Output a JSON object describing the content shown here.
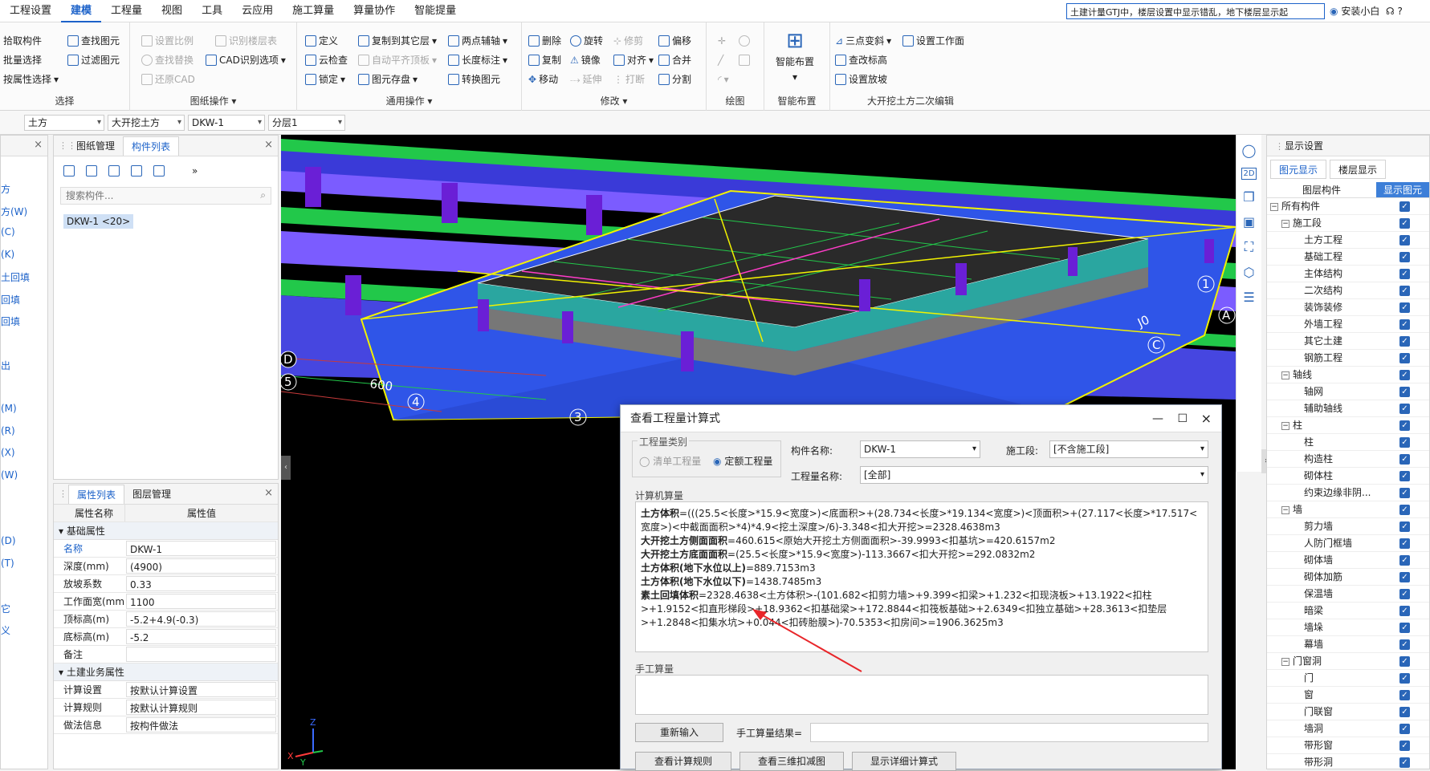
{
  "menu": {
    "tabs": [
      "工程设置",
      "建模",
      "工程量",
      "视图",
      "工具",
      "云应用",
      "施工算量",
      "算量协作",
      "智能提量"
    ],
    "active": 1,
    "search_value": "土建计量GTJ中，楼层设置中显示错乱，地下楼层显示起",
    "user": "安装小白"
  },
  "ribbon": {
    "select": {
      "label": "选择",
      "items": [
        "拾取构件",
        "批量选择",
        "按属性选择",
        "查找图元",
        "过滤图元"
      ]
    },
    "drawing": {
      "label": "图纸操作",
      "items": [
        "设置比例",
        "识别楼层表",
        "查找替换",
        "CAD识别选项",
        "还原CAD"
      ]
    },
    "common": {
      "label": "通用操作",
      "items": [
        "定义",
        "复制到其它层",
        "两点辅轴",
        "云检查",
        "自动平齐顶板",
        "长度标注",
        "锁定",
        "图元存盘",
        "转换图元"
      ]
    },
    "modify": {
      "label": "修改",
      "items": [
        "删除",
        "旋转",
        "修剪",
        "偏移",
        "复制",
        "镜像",
        "对齐",
        "合并",
        "移动",
        "延伸",
        "打断",
        "分割"
      ]
    },
    "draw": {
      "label": "绘图"
    },
    "smart": {
      "label": "智能布置",
      "button": "智能布置"
    },
    "pit": {
      "label": "大开挖土方二次编辑",
      "items": [
        "三点变斜",
        "设置工作面",
        "查改标高",
        "设置放坡"
      ]
    }
  },
  "selectors": [
    "土方",
    "大开挖土方",
    "DKW-1",
    "分层1"
  ],
  "left_narrow": {
    "items": [
      "方",
      "方(W)",
      "(C)",
      "(K)",
      "土回填",
      "回填",
      "回填",
      "",
      "出",
      "",
      "(M)",
      "(R)",
      "(X)",
      "(W)",
      "",
      "",
      "(D)",
      "(T)",
      "",
      "它",
      "义"
    ]
  },
  "component_panel": {
    "tabs": [
      "图纸管理",
      "构件列表"
    ],
    "active": 1,
    "search_placeholder": "搜索构件...",
    "item": "DKW-1 <20>"
  },
  "property_panel": {
    "tabs": [
      "属性列表",
      "图层管理"
    ],
    "active": 0,
    "headers": [
      "属性名称",
      "属性值"
    ],
    "section1": "基础属性",
    "rows": [
      {
        "name": "名称",
        "value": "DKW-1",
        "blue": true
      },
      {
        "name": "深度(mm)",
        "value": "(4900)"
      },
      {
        "name": "放坡系数",
        "value": "0.33"
      },
      {
        "name": "工作面宽(mm)",
        "value": "1100"
      },
      {
        "name": "顶标高(m)",
        "value": "-5.2+4.9(-0.3)"
      },
      {
        "name": "底标高(m)",
        "value": "-5.2"
      },
      {
        "name": "备注",
        "value": ""
      }
    ],
    "section2": "土建业务属性",
    "rows2": [
      {
        "name": "计算设置",
        "value": "按默认计算设置"
      },
      {
        "name": "计算规则",
        "value": "按默认计算规则"
      },
      {
        "name": "做法信息",
        "value": "按构件做法"
      }
    ]
  },
  "viewport": {
    "axis_labels": [
      "D",
      "5",
      "4",
      "3",
      "1",
      "A",
      "J0",
      "C"
    ],
    "dim_text": "600"
  },
  "display_panel": {
    "title": "显示设置",
    "tabs": [
      "图元显示",
      "楼层显示"
    ],
    "active": 0,
    "headers": [
      "图层构件",
      "显示图元"
    ],
    "rows": [
      {
        "label": "所有构件",
        "level": 0,
        "exp": true
      },
      {
        "label": "施工段",
        "level": 1,
        "exp": true
      },
      {
        "label": "土方工程",
        "level": 2
      },
      {
        "label": "基础工程",
        "level": 2
      },
      {
        "label": "主体结构",
        "level": 2
      },
      {
        "label": "二次结构",
        "level": 2
      },
      {
        "label": "装饰装修",
        "level": 2
      },
      {
        "label": "外墙工程",
        "level": 2
      },
      {
        "label": "其它土建",
        "level": 2
      },
      {
        "label": "钢筋工程",
        "level": 2
      },
      {
        "label": "轴线",
        "level": 1,
        "exp": true
      },
      {
        "label": "轴网",
        "level": 2
      },
      {
        "label": "辅助轴线",
        "level": 2
      },
      {
        "label": "柱",
        "level": 1,
        "exp": true
      },
      {
        "label": "柱",
        "level": 2
      },
      {
        "label": "构造柱",
        "level": 2
      },
      {
        "label": "砌体柱",
        "level": 2
      },
      {
        "label": "约束边缘非阴...",
        "level": 2
      },
      {
        "label": "墙",
        "level": 1,
        "exp": true
      },
      {
        "label": "剪力墙",
        "level": 2
      },
      {
        "label": "人防门框墙",
        "level": 2
      },
      {
        "label": "砌体墙",
        "level": 2
      },
      {
        "label": "砌体加筋",
        "level": 2
      },
      {
        "label": "保温墙",
        "level": 2
      },
      {
        "label": "暗梁",
        "level": 2
      },
      {
        "label": "墙垛",
        "level": 2
      },
      {
        "label": "幕墙",
        "level": 2
      },
      {
        "label": "门窗洞",
        "level": 1,
        "exp": true
      },
      {
        "label": "门",
        "level": 2
      },
      {
        "label": "窗",
        "level": 2
      },
      {
        "label": "门联窗",
        "level": 2
      },
      {
        "label": "墙洞",
        "level": 2
      },
      {
        "label": "带形窗",
        "level": 2
      },
      {
        "label": "带形洞",
        "level": 2
      }
    ]
  },
  "dialog": {
    "title": "查看工程量计算式",
    "category_label": "工程量类别",
    "radio1": "清单工程量",
    "radio2": "定额工程量",
    "component_name_label": "构件名称:",
    "component_name": "DKW-1",
    "stage_label": "施工段:",
    "stage": "[不含施工段]",
    "qty_name_label": "工程量名称:",
    "qty_name": "[全部]",
    "computer_label": "计算机算量",
    "formulas": [
      {
        "k": "土方体积",
        "v": "=(((25.5<长度>*15.9<宽度>)<底面积>+(28.734<长度>*19.134<宽度>)<顶面积>+(27.117<长度>*17.517<宽度>)<中截面面积>*4)*4.9<挖土深度>/6)-3.348<扣大开挖>=2328.4638m3"
      },
      {
        "k": "大开挖土方侧面面积",
        "v": "=460.615<原始大开挖土方侧面面积>-39.9993<扣基坑>=420.6157m2"
      },
      {
        "k": "大开挖土方底面面积",
        "v": "=(25.5<长度>*15.9<宽度>)-113.3667<扣大开挖>=292.0832m2"
      },
      {
        "k": "土方体积(地下水位以上)",
        "v": "=889.7153m3"
      },
      {
        "k": "土方体积(地下水位以下)",
        "v": "=1438.7485m3"
      },
      {
        "k": "素土回填体积",
        "v": "=2328.4638<土方体积>-(101.682<扣剪力墙>+9.399<扣梁>+1.232<扣现浇板>+13.1922<扣柱>+1.9152<扣直形梯段>+18.9362<扣基础梁>+172.8844<扣筏板基础>+2.6349<扣独立基础>+28.3613<扣垫层>+1.2848<扣集水坑>+0.044<扣砖胎膜>)-70.5353<扣房间>=1906.3625m3"
      }
    ],
    "manual_label": "手工算量",
    "reenter": "重新输入",
    "manual_result_label": "手工算量结果=",
    "buttons": [
      "查看计算规则",
      "查看三维扣减图",
      "显示详细计算式"
    ]
  },
  "colors": {
    "accent": "#1c62c9",
    "pit": "#2f55e8",
    "beam": "#22c84a",
    "column": "#6a1fd6",
    "slab": "#7b5cff"
  }
}
